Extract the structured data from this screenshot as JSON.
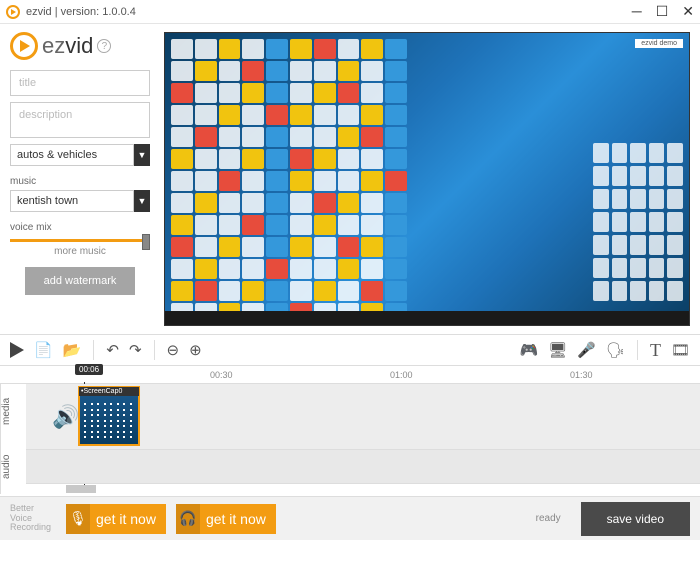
{
  "window": {
    "title": "ezvid | version: 1.0.0.4"
  },
  "logo": {
    "text_light": "ez",
    "text_bold": "vid"
  },
  "inputs": {
    "title_placeholder": "title",
    "desc_placeholder": "description",
    "category_value": "autos & vehicles",
    "music_label": "music",
    "music_value": "kentish town",
    "voicemix_label": "voice mix",
    "more_music": "more music",
    "watermark_btn": "add watermark"
  },
  "preview": {
    "badge": "ezvid demo"
  },
  "timeline": {
    "playhead_time": "00:06",
    "marks": {
      "m1": "00:30",
      "m2": "01:00",
      "m3": "01:30"
    },
    "media_label": "media",
    "audio_label": "audio",
    "clip_name": "•ScreenCap0"
  },
  "footer": {
    "promo_label": "Better\nVoice\nRecording",
    "get_it": "get it now",
    "status": "ready",
    "save": "save video"
  }
}
